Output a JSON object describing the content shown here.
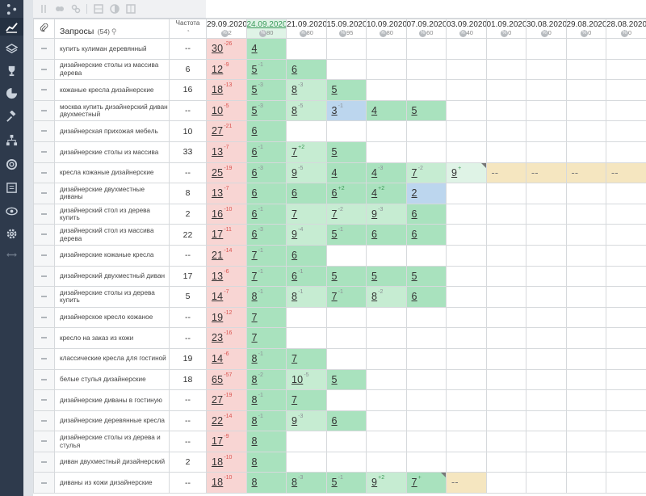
{
  "sidebar": {
    "icons": [
      "share-icon",
      "chart-icon",
      "layers-icon",
      "trophy-icon",
      "pie-chart-icon",
      "gavel-icon",
      "sitemap-icon",
      "lifebuoy-icon",
      "report-icon",
      "eye-icon",
      "gear-icon",
      "expand-icon"
    ]
  },
  "header": {
    "queries_title": "Запросы",
    "queries_count": "(54)",
    "freq_title": "Частота",
    "dates": [
      {
        "date": "29.09.2020",
        "sub": "2"
      },
      {
        "date": "24.09.2020",
        "sub": "80",
        "highlight": true
      },
      {
        "date": "21.09.2020",
        "sub": "80"
      },
      {
        "date": "15.09.2020",
        "sub": "95"
      },
      {
        "date": "10.09.2020",
        "sub": "80"
      },
      {
        "date": "07.09.2020",
        "sub": "60"
      },
      {
        "date": "03.09.2020",
        "sub": "40"
      },
      {
        "date": "01.09.2020",
        "sub": "0"
      },
      {
        "date": "30.08.2020",
        "sub": "0"
      },
      {
        "date": "29.08.2020",
        "sub": "0"
      },
      {
        "date": "28.08.2020",
        "sub": "0"
      }
    ]
  },
  "rows": [
    {
      "q": "купить кулиман деревянный",
      "f": "--",
      "c": [
        [
          "30",
          "-26",
          "red"
        ],
        [
          "4",
          "",
          "g1"
        ]
      ]
    },
    {
      "q": "дизайнерские столы из массива дерева",
      "f": "6",
      "c": [
        [
          "12",
          "-9",
          "red"
        ],
        [
          "5",
          "-1",
          "g1"
        ],
        [
          "6",
          "",
          "g1"
        ]
      ]
    },
    {
      "q": "кожаные кресла дизайнерские",
      "f": "16",
      "c": [
        [
          "18",
          "-13",
          "red"
        ],
        [
          "5",
          "-3",
          "g1"
        ],
        [
          "8",
          "-3",
          "g2"
        ],
        [
          "5",
          "",
          "g1"
        ]
      ]
    },
    {
      "q": "москва купить дизайнерский диван двухместный",
      "f": "--",
      "c": [
        [
          "10",
          "-5",
          "red"
        ],
        [
          "5",
          "-3",
          "g1"
        ],
        [
          "8",
          "-5",
          "g2"
        ],
        [
          "3",
          "-1",
          "blue"
        ],
        [
          "4",
          "",
          "g1"
        ],
        [
          "5",
          "",
          "g1"
        ]
      ]
    },
    {
      "q": "дизайнерская прихожая мебель",
      "f": "10",
      "c": [
        [
          "27",
          "-21",
          "red"
        ],
        [
          "6",
          "",
          "g1"
        ]
      ]
    },
    {
      "q": "дизайнерские столы из массива",
      "f": "33",
      "c": [
        [
          "13",
          "-7",
          "red"
        ],
        [
          "6",
          "-1",
          "g1"
        ],
        [
          "7",
          "+2",
          "g2"
        ],
        [
          "5",
          "",
          "g1"
        ]
      ]
    },
    {
      "q": "кресла кожаные дизайнерские",
      "f": "--",
      "c": [
        [
          "25",
          "-19",
          "red"
        ],
        [
          "6",
          "-3",
          "g1"
        ],
        [
          "9",
          "-5",
          "g2"
        ],
        [
          "4",
          "",
          "g1"
        ],
        [
          "4",
          "-3",
          "g1"
        ],
        [
          "7",
          "-2",
          "g2"
        ],
        [
          "9",
          "+",
          "g3",
          "corner"
        ],
        [
          "--",
          "",
          "yel"
        ],
        [
          "--",
          "",
          "yel"
        ],
        [
          "--",
          "",
          "yel"
        ],
        [
          "--",
          "",
          "yel"
        ]
      ]
    },
    {
      "q": "дизайнерские двухместные диваны",
      "f": "8",
      "c": [
        [
          "13",
          "-7",
          "red"
        ],
        [
          "6",
          "",
          "g1"
        ],
        [
          "6",
          "",
          "g1"
        ],
        [
          "6",
          "+2",
          "g1"
        ],
        [
          "4",
          "+2",
          "g1"
        ],
        [
          "2",
          "",
          "blue"
        ]
      ]
    },
    {
      "q": "дизайнерский стол из дерева купить",
      "f": "2",
      "c": [
        [
          "16",
          "-10",
          "red"
        ],
        [
          "6",
          "-1",
          "g1"
        ],
        [
          "7",
          "",
          "g2"
        ],
        [
          "7",
          "-2",
          "g2"
        ],
        [
          "9",
          "-3",
          "g2"
        ],
        [
          "6",
          "",
          "g1"
        ]
      ]
    },
    {
      "q": "дизайнерский стол из массива дерева",
      "f": "22",
      "c": [
        [
          "17",
          "-11",
          "red"
        ],
        [
          "6",
          "-3",
          "g1"
        ],
        [
          "9",
          "-4",
          "g2"
        ],
        [
          "5",
          "-1",
          "g1"
        ],
        [
          "6",
          "",
          "g1"
        ],
        [
          "6",
          "",
          "g1"
        ]
      ]
    },
    {
      "q": "дизайнерские кожаные кресла",
      "f": "--",
      "c": [
        [
          "21",
          "-14",
          "red"
        ],
        [
          "7",
          "-1",
          "g1"
        ],
        [
          "6",
          "",
          "g1"
        ]
      ]
    },
    {
      "q": "дизайнерский двухместный диван",
      "f": "17",
      "c": [
        [
          "13",
          "-6",
          "red"
        ],
        [
          "7",
          "-1",
          "g1"
        ],
        [
          "6",
          "-1",
          "g1"
        ],
        [
          "5",
          "",
          "g1"
        ],
        [
          "5",
          "",
          "g1"
        ],
        [
          "5",
          "",
          "g1"
        ]
      ]
    },
    {
      "q": "дизайнерские столы из дерева купить",
      "f": "5",
      "c": [
        [
          "14",
          "-7",
          "red"
        ],
        [
          "8",
          "-1",
          "g1"
        ],
        [
          "8",
          "-1",
          "g2"
        ],
        [
          "7",
          "-1",
          "g1"
        ],
        [
          "8",
          "-2",
          "g2"
        ],
        [
          "6",
          "",
          "g1"
        ]
      ]
    },
    {
      "q": "дизайнерское кресло кожаное",
      "f": "--",
      "c": [
        [
          "19",
          "-12",
          "red"
        ],
        [
          "7",
          "",
          "g1"
        ]
      ]
    },
    {
      "q": "кресло на заказ из кожи",
      "f": "--",
      "c": [
        [
          "23",
          "-16",
          "red"
        ],
        [
          "7",
          "",
          "g1"
        ]
      ]
    },
    {
      "q": "классические кресла для гостиной",
      "f": "19",
      "c": [
        [
          "14",
          "-6",
          "red"
        ],
        [
          "8",
          "-1",
          "g1"
        ],
        [
          "7",
          "",
          "g1"
        ]
      ]
    },
    {
      "q": "белые стулья дизайнерские",
      "f": "18",
      "c": [
        [
          "65",
          "-57",
          "red"
        ],
        [
          "8",
          "-2",
          "g1"
        ],
        [
          "10",
          "-5",
          "g2"
        ],
        [
          "5",
          "",
          "g1"
        ]
      ]
    },
    {
      "q": "дизайнерские диваны в гостиную",
      "f": "--",
      "c": [
        [
          "27",
          "-19",
          "red"
        ],
        [
          "8",
          "-1",
          "g1"
        ],
        [
          "7",
          "",
          "g1"
        ]
      ]
    },
    {
      "q": "дизайнерские деревянные кресла",
      "f": "--",
      "c": [
        [
          "22",
          "-14",
          "red"
        ],
        [
          "8",
          "-1",
          "g1"
        ],
        [
          "9",
          "-3",
          "g2"
        ],
        [
          "6",
          "",
          "g1"
        ]
      ]
    },
    {
      "q": "дизайнерские столы из дерева и стулья",
      "f": "--",
      "c": [
        [
          "17",
          "-9",
          "red"
        ],
        [
          "8",
          "",
          "g1"
        ]
      ]
    },
    {
      "q": "диван двухместный дизайнерский",
      "f": "2",
      "c": [
        [
          "18",
          "-10",
          "red"
        ],
        [
          "8",
          "",
          "g1"
        ]
      ]
    },
    {
      "q": "диваны из кожи дизайнерские",
      "f": "--",
      "c": [
        [
          "18",
          "-10",
          "red"
        ],
        [
          "8",
          "",
          "g1"
        ],
        [
          "8",
          "-3",
          "g1"
        ],
        [
          "5",
          "-1",
          "g1"
        ],
        [
          "9",
          "+2",
          "g2"
        ],
        [
          "7",
          "+",
          "g1",
          "corner"
        ],
        [
          "--",
          "",
          "yel"
        ]
      ]
    }
  ]
}
